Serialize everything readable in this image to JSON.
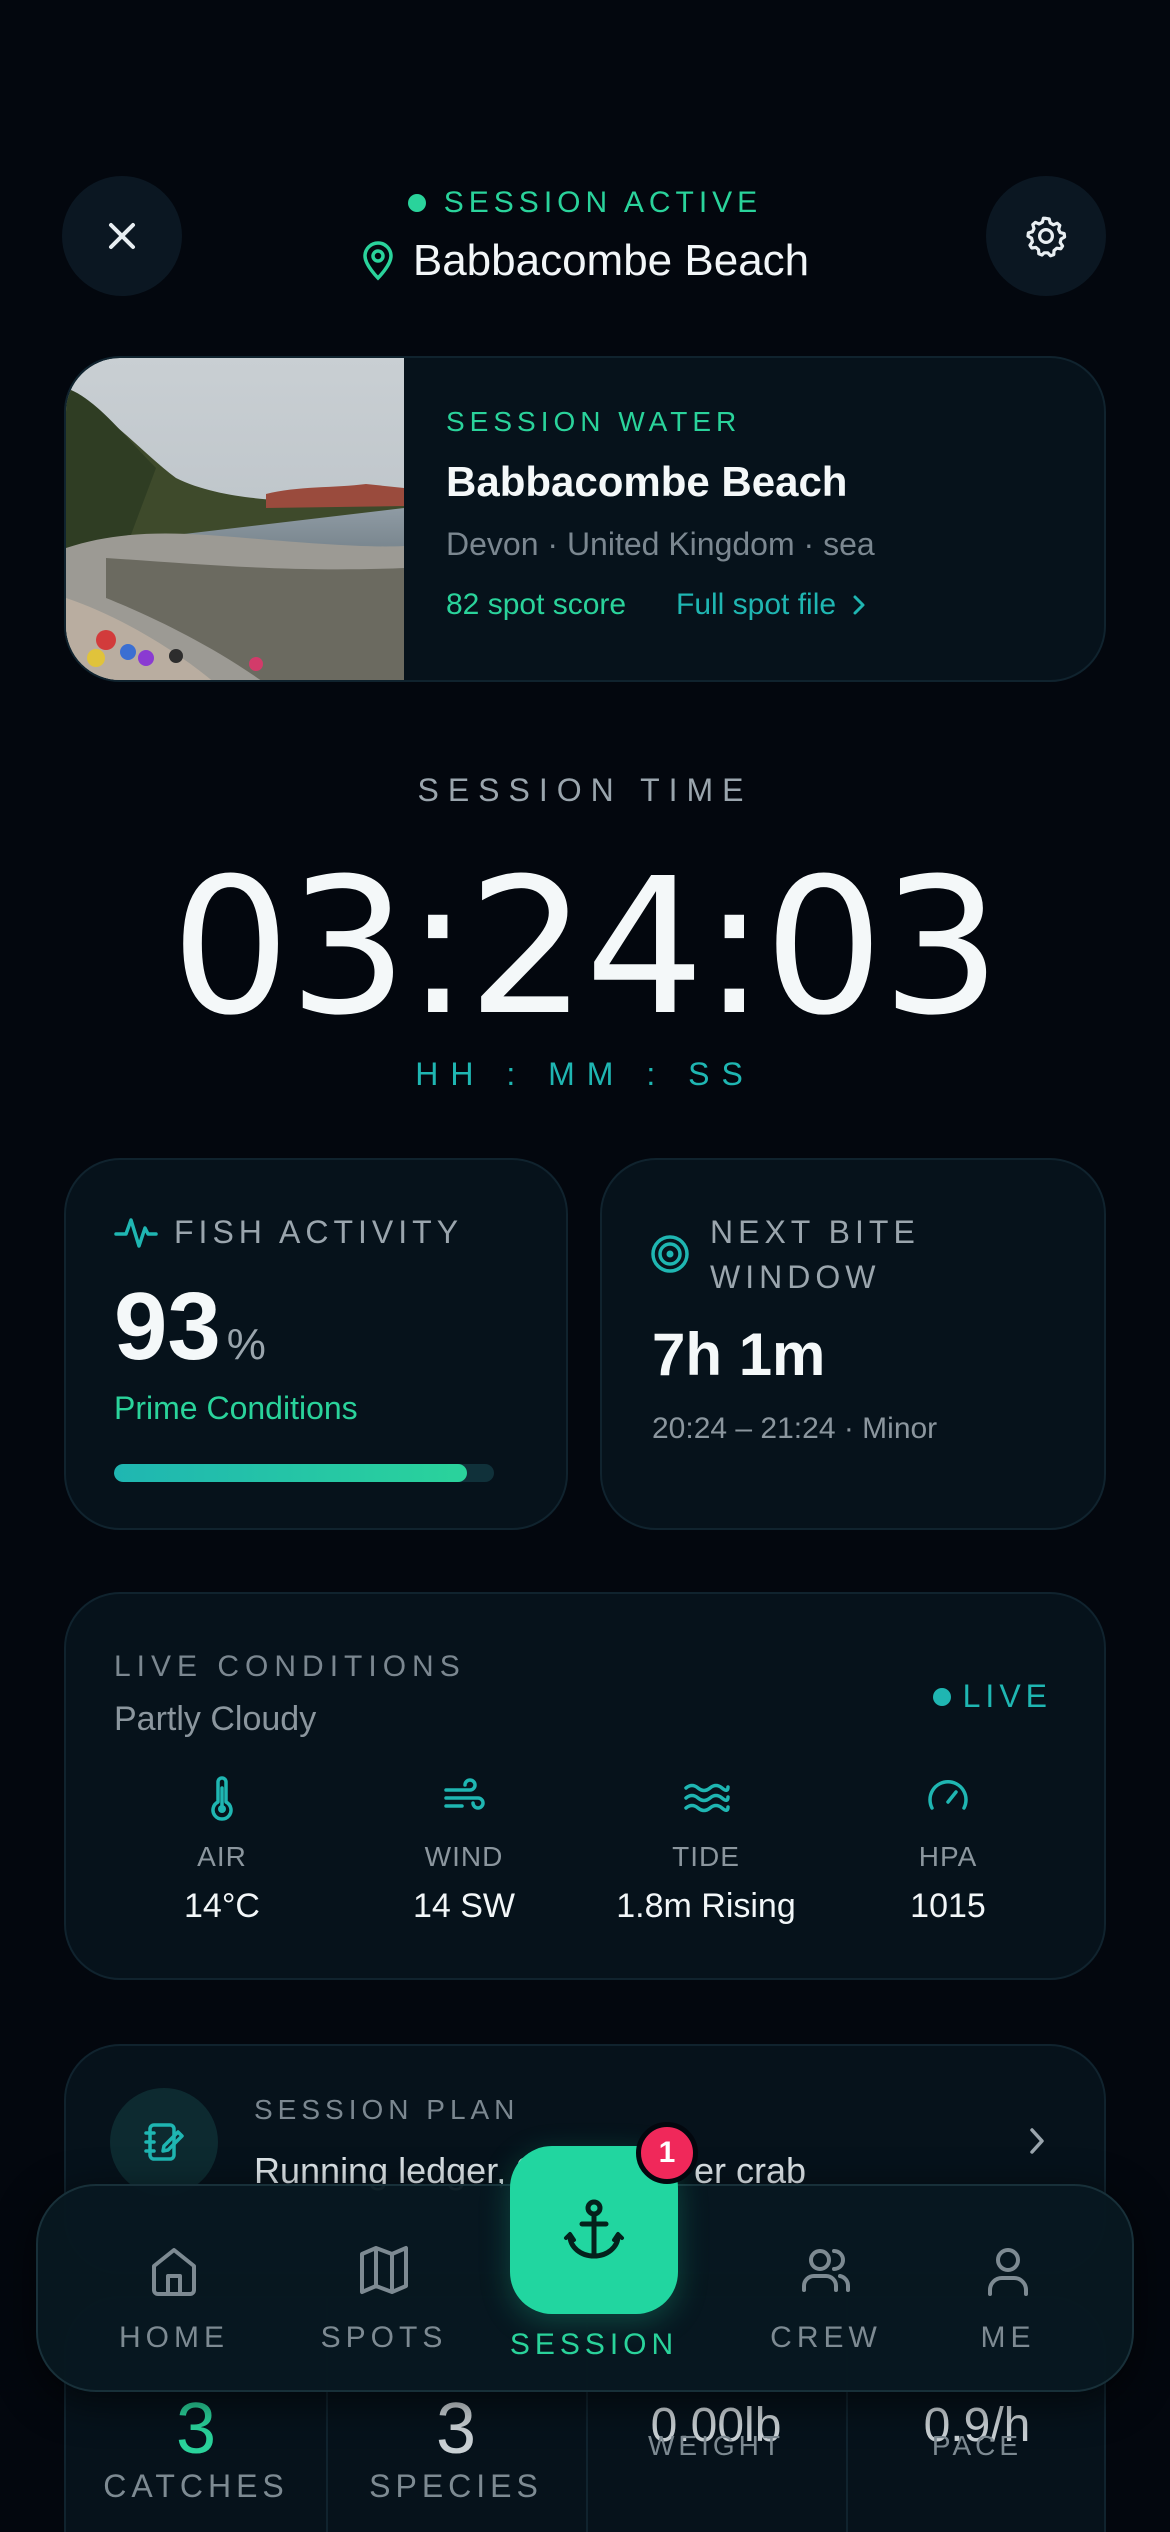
{
  "header": {
    "status": "SESSION ACTIVE",
    "location": "Babbacombe Beach"
  },
  "water": {
    "eyebrow": "SESSION WATER",
    "name": "Babbacombe Beach",
    "meta": "Devon · United Kingdom · sea",
    "score": "82 spot score",
    "file_link": "Full spot file"
  },
  "timer": {
    "label": "SESSION TIME",
    "value": "03:24:03",
    "units": "HH : MM : SS"
  },
  "fish_activity": {
    "title": "FISH ACTIVITY",
    "value": "93",
    "unit": "%",
    "status": "Prime Conditions",
    "progress": 0.93
  },
  "bite_window": {
    "title_line1": "NEXT BITE",
    "title_line2": "WINDOW",
    "countdown": "7h 1m",
    "window": "20:24 – 21:24 · Minor"
  },
  "conditions": {
    "title": "LIVE CONDITIONS",
    "summary": "Partly Cloudy",
    "live_badge": "LIVE",
    "items": [
      {
        "label": "AIR",
        "value": "14°C",
        "icon": "thermometer-icon"
      },
      {
        "label": "WIND",
        "value": "14 SW",
        "icon": "wind-icon"
      },
      {
        "label": "TIDE",
        "value": "1.8m Rising",
        "icon": "waves-icon"
      },
      {
        "label": "HPA",
        "value": "1015",
        "icon": "gauge-icon"
      }
    ]
  },
  "plan": {
    "title": "SESSION PLAN",
    "text_left": "Running ledger, 3",
    "text_right": "er crab"
  },
  "stats": {
    "catches_value": "3",
    "catches_label": "CATCHES",
    "species_value": "3",
    "species_label": "SPECIES",
    "weight_value": "0.00lb",
    "weight_label": "WEIGHT",
    "pace_value": "0.9/h",
    "pace_label": "PACE"
  },
  "nav": {
    "home": "HOME",
    "spots": "SPOTS",
    "session": "SESSION",
    "crew": "CREW",
    "me": "ME",
    "session_badge": "1"
  },
  "colors": {
    "background": "#03070e",
    "card": "#06121b",
    "accent_green": "#2ad39b",
    "accent_teal": "#1fb6b2",
    "badge_red": "#f0285a"
  }
}
